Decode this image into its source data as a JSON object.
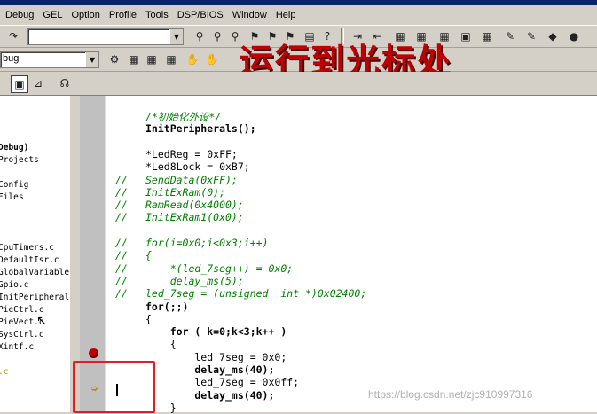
{
  "menu": [
    "Debug",
    "GEL",
    "Option",
    "Profile",
    "Tools",
    "DSP/BIOS",
    "Window",
    "Help"
  ],
  "toolbar2_combo_value": "bug",
  "overlay_title": "运行到光标处",
  "project_tree": [
    {
      "label": "Debug)",
      "bold": true
    },
    {
      "label": "Projects",
      "bold": false
    },
    {
      "label": "Config",
      "bold": false
    },
    {
      "label": "Files",
      "bold": false
    },
    {
      "label": "CpuTimers.c",
      "bold": false
    },
    {
      "label": "DefaultIsr.c",
      "bold": false
    },
    {
      "label": "GlobalVariableI",
      "bold": false
    },
    {
      "label": "Gpio.c",
      "bold": false
    },
    {
      "label": "InitPeripherals",
      "bold": false
    },
    {
      "label": "PieCtrl.c",
      "bold": false
    },
    {
      "label": "PieVect.c",
      "bold": false
    },
    {
      "label": "SysCtrl.c",
      "bold": false
    },
    {
      "label": "Xintf.c",
      "bold": false
    },
    {
      "label": ".c",
      "bold": false,
      "selected": true
    }
  ],
  "code": [
    {
      "prefix": "",
      "text": "/*初始化外设*/",
      "style": "comment"
    },
    {
      "prefix": "",
      "text": "InitPeripherals();",
      "style": "bold"
    },
    {
      "prefix": "",
      "text": "",
      "style": "plain"
    },
    {
      "prefix": "",
      "text": "*LedReg = 0xFF;",
      "style": "plain"
    },
    {
      "prefix": "",
      "text": "*Led8Lock = 0xB7;",
      "style": "plain"
    },
    {
      "prefix": "//",
      "text": "SendData(0xFF);",
      "style": "comment"
    },
    {
      "prefix": "//",
      "text": "InitExRam(0);",
      "style": "comment"
    },
    {
      "prefix": "//",
      "text": "RamRead(0x4000);",
      "style": "comment"
    },
    {
      "prefix": "//",
      "text": "InitExRam1(0x0);",
      "style": "comment"
    },
    {
      "prefix": "",
      "text": "",
      "style": "plain"
    },
    {
      "prefix": "//",
      "text": "for(i=0x0;i<0x3;i++)",
      "style": "comment"
    },
    {
      "prefix": "//",
      "text": "{",
      "style": "comment"
    },
    {
      "prefix": "//",
      "text": "    *(led_7seg++) = 0x0;",
      "style": "comment"
    },
    {
      "prefix": "//",
      "text": "    delay_ms(5);",
      "style": "comment"
    },
    {
      "prefix": "//",
      "text": "led_7seg = (unsigned  int *)0x02400;",
      "style": "comment"
    },
    {
      "prefix": "",
      "text": "for(;;)",
      "style": "bold"
    },
    {
      "prefix": "",
      "text": "{",
      "style": "plain"
    },
    {
      "prefix": "",
      "text": "    for ( k=0;k<3;k++ )",
      "style": "bold"
    },
    {
      "prefix": "",
      "text": "    {",
      "style": "plain"
    },
    {
      "prefix": "",
      "text": "        led_7seg = 0x0;",
      "style": "plain"
    },
    {
      "prefix": "",
      "text": "        delay_ms(40);",
      "style": "bold"
    },
    {
      "prefix": "",
      "text": "        led_7seg = 0x0ff;",
      "style": "plain"
    },
    {
      "prefix": "",
      "text": "        delay_ms(40);",
      "style": "bold"
    },
    {
      "prefix": "",
      "text": "    }",
      "style": "plain"
    }
  ],
  "watermark": "https://blog.csdn.net/zjc910997316",
  "colors": {
    "breakpoint": "#c00000",
    "highlight_box": "#e02020",
    "overlay": "#c00000"
  }
}
